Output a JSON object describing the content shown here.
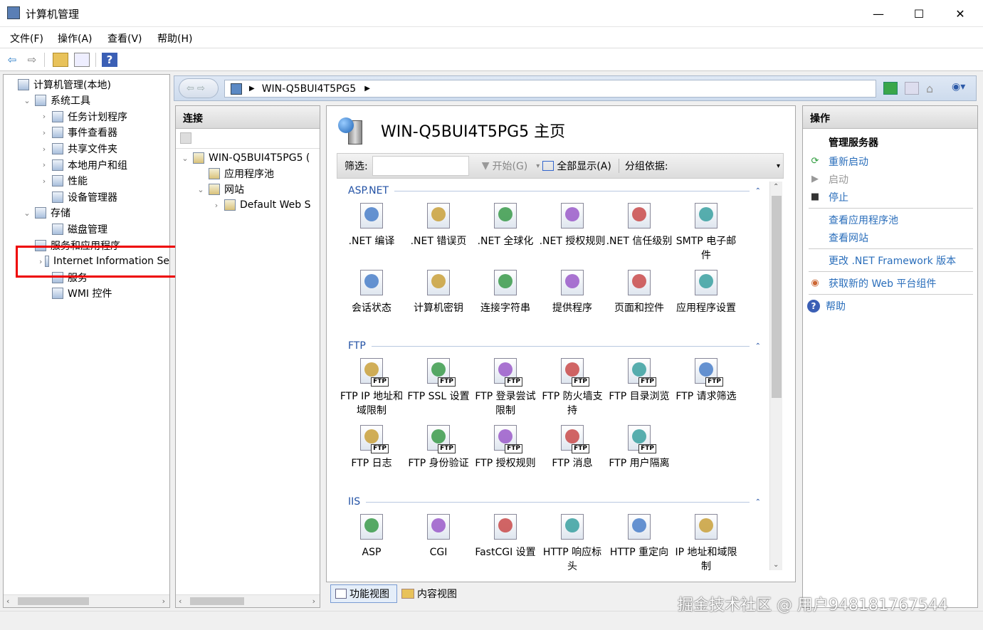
{
  "window": {
    "title": "计算机管理",
    "minimize": "—",
    "maximize": "☐",
    "close": "✕"
  },
  "menu": [
    "文件(F)",
    "操作(A)",
    "查看(V)",
    "帮助(H)"
  ],
  "tree": [
    {
      "label": "计算机管理(本地)",
      "indent": 0,
      "exp": "",
      "icon": "computer-icon"
    },
    {
      "label": "系统工具",
      "indent": 1,
      "exp": "⌄",
      "icon": "tools-icon"
    },
    {
      "label": "任务计划程序",
      "indent": 2,
      "exp": "›",
      "icon": "clock-icon"
    },
    {
      "label": "事件查看器",
      "indent": 2,
      "exp": "›",
      "icon": "event-viewer-icon"
    },
    {
      "label": "共享文件夹",
      "indent": 2,
      "exp": "›",
      "icon": "shared-folder-icon"
    },
    {
      "label": "本地用户和组",
      "indent": 2,
      "exp": "›",
      "icon": "users-icon"
    },
    {
      "label": "性能",
      "indent": 2,
      "exp": "›",
      "icon": "performance-icon"
    },
    {
      "label": "设备管理器",
      "indent": 2,
      "exp": "",
      "icon": "device-manager-icon"
    },
    {
      "label": "存储",
      "indent": 1,
      "exp": "⌄",
      "icon": "storage-icon"
    },
    {
      "label": "磁盘管理",
      "indent": 2,
      "exp": "",
      "icon": "disk-icon"
    },
    {
      "label": "服务和应用程序",
      "indent": 1,
      "exp": "⌄",
      "icon": "services-apps-icon"
    },
    {
      "label": "Internet Information Se",
      "indent": 2,
      "exp": "›",
      "icon": "iis-icon"
    },
    {
      "label": "服务",
      "indent": 2,
      "exp": "",
      "icon": "services-icon"
    },
    {
      "label": "WMI 控件",
      "indent": 2,
      "exp": "",
      "icon": "wmi-icon"
    }
  ],
  "address": {
    "path": "WIN-Q5BUI4T5PG5"
  },
  "connections": {
    "title": "连接",
    "nodes": [
      {
        "label": "WIN-Q5BUI4T5PG5 (",
        "indent": 0,
        "exp": "⌄",
        "icon": "server-icon"
      },
      {
        "label": "应用程序池",
        "indent": 1,
        "exp": "",
        "icon": "app-pool-icon"
      },
      {
        "label": "网站",
        "indent": 1,
        "exp": "⌄",
        "icon": "sites-folder-icon"
      },
      {
        "label": "Default Web S",
        "indent": 2,
        "exp": "›",
        "icon": "globe-icon"
      }
    ]
  },
  "main": {
    "title": "WIN-Q5BUI4T5PG5 主页",
    "filter_label": "筛选:",
    "filter_value": "",
    "start": "开始(G)",
    "showall": "全部显示(A)",
    "groupby": "分组依据:"
  },
  "sections": [
    {
      "title": "ASP.NET",
      "items": [
        {
          "label": ".NET 编译",
          "icon": "net-compile-icon"
        },
        {
          "label": ".NET 错误页",
          "icon": "net-error-icon"
        },
        {
          "label": ".NET 全球化",
          "icon": "net-globalization-icon"
        },
        {
          "label": ".NET 授权规则",
          "icon": "net-authz-icon"
        },
        {
          "label": ".NET 信任级别",
          "icon": "net-trust-icon"
        },
        {
          "label": "SMTP 电子邮件",
          "icon": "smtp-icon"
        },
        {
          "label": "会话状态",
          "icon": "session-icon"
        },
        {
          "label": "计算机密钥",
          "icon": "machine-key-icon"
        },
        {
          "label": "连接字符串",
          "icon": "conn-string-icon"
        },
        {
          "label": "提供程序",
          "icon": "providers-icon"
        },
        {
          "label": "页面和控件",
          "icon": "pages-controls-icon"
        },
        {
          "label": "应用程序设置",
          "icon": "app-settings-icon"
        }
      ]
    },
    {
      "title": "FTP",
      "items": [
        {
          "label": "FTP IP 地址和域限制",
          "icon": "ftp-ip-icon"
        },
        {
          "label": "FTP SSL 设置",
          "icon": "ftp-ssl-icon"
        },
        {
          "label": "FTP 登录尝试限制",
          "icon": "ftp-logon-icon"
        },
        {
          "label": "FTP 防火墙支持",
          "icon": "ftp-firewall-icon"
        },
        {
          "label": "FTP 目录浏览",
          "icon": "ftp-dir-icon"
        },
        {
          "label": "FTP 请求筛选",
          "icon": "ftp-filter-icon"
        },
        {
          "label": "FTP 日志",
          "icon": "ftp-log-icon"
        },
        {
          "label": "FTP 身份验证",
          "icon": "ftp-auth-icon"
        },
        {
          "label": "FTP 授权规则",
          "icon": "ftp-authz-icon"
        },
        {
          "label": "FTP 消息",
          "icon": "ftp-msg-icon"
        },
        {
          "label": "FTP 用户隔离",
          "icon": "ftp-isolation-icon"
        }
      ]
    },
    {
      "title": "IIS",
      "items": [
        {
          "label": "ASP",
          "icon": "asp-icon"
        },
        {
          "label": "CGI",
          "icon": "cgi-icon"
        },
        {
          "label": "FastCGI 设置",
          "icon": "fastcgi-icon"
        },
        {
          "label": "HTTP 响应标头",
          "icon": "http-headers-icon"
        },
        {
          "label": "HTTP 重定向",
          "icon": "http-redirect-icon"
        },
        {
          "label": "IP 地址和域限制",
          "icon": "ip-restrict-icon"
        }
      ]
    }
  ],
  "actions": {
    "title": "操作",
    "group": "管理服务器",
    "items": [
      {
        "label": "重新启动",
        "icon": "restart-icon",
        "enabled": true,
        "sepAfter": false
      },
      {
        "label": "启动",
        "icon": "start-icon",
        "enabled": false,
        "sepAfter": false
      },
      {
        "label": "停止",
        "icon": "stop-icon",
        "enabled": true,
        "sepAfter": true
      },
      {
        "label": "查看应用程序池",
        "icon": "",
        "enabled": true,
        "sepAfter": false
      },
      {
        "label": "查看网站",
        "icon": "",
        "enabled": true,
        "sepAfter": true
      },
      {
        "label": "更改 .NET Framework 版本",
        "icon": "",
        "enabled": true,
        "sepAfter": true
      },
      {
        "label": "获取新的 Web 平台组件",
        "icon": "web-platform-icon",
        "enabled": true,
        "sepAfter": true
      },
      {
        "label": "帮助",
        "icon": "help-icon",
        "enabled": true,
        "sepAfter": false
      }
    ]
  },
  "views": {
    "features": "功能视图",
    "content": "内容视图"
  },
  "watermark": "掘金技术社区 @ 用户948181767544"
}
